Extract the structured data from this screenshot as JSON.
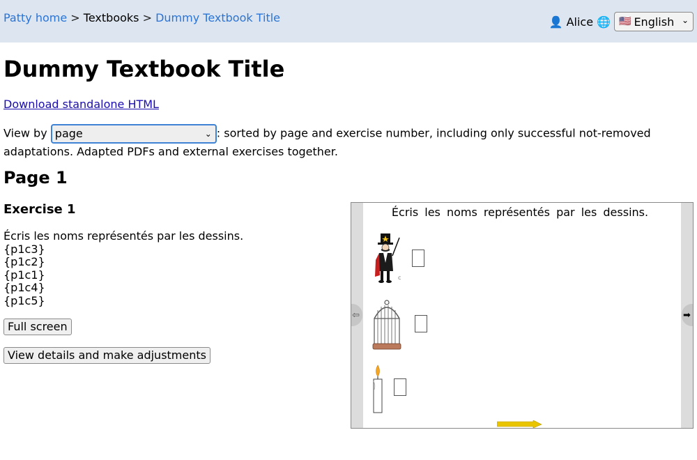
{
  "breadcrumb": {
    "home": "Patty home",
    "sep1": ">",
    "textbooks": "Textbooks",
    "sep2": ">",
    "current": "Dummy Textbook Title"
  },
  "user": {
    "name": "Alice",
    "icon": "user-icon",
    "language_icon": "globe-icon"
  },
  "language": {
    "flag": "🇺🇸",
    "selected": "English"
  },
  "title": "Dummy Textbook Title",
  "download_link": "Download standalone HTML",
  "view_by": {
    "label": "View by",
    "selected": "page",
    "description": ": sorted by page and exercise number, including only successful not-removed adaptations. Adapted PDFs and external exercises together."
  },
  "page_heading": "Page 1",
  "exercise": {
    "heading": "Exercise 1",
    "instruction": "Écris les noms représentés par les dessins.",
    "items": [
      "{p1c3}",
      "{p1c2}",
      "{p1c1}",
      "{p1c4}",
      "{p1c5}"
    ],
    "fullscreen_button": "Full screen",
    "details_button": "View details and make adjustments"
  },
  "preview": {
    "instruction": "Écris les noms représentés par les dessins.",
    "prev_icon": "arrow-left-icon",
    "next_icon": "arrow-right-icon",
    "pictures": [
      "magician",
      "birdcage",
      "candle"
    ]
  },
  "colors": {
    "topbar": "#dde6f0",
    "link": "#2a74d6",
    "select_focus": "#3e82d6"
  }
}
